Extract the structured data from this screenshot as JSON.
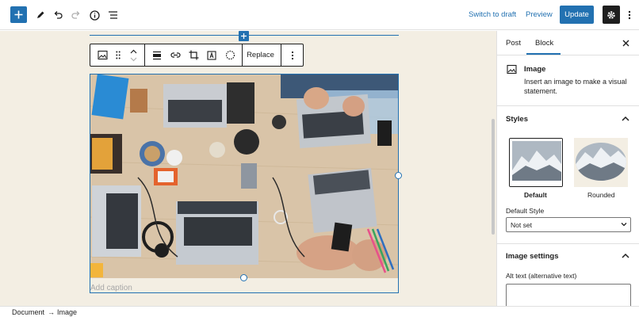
{
  "toolbar": {
    "add_icon": "plus-icon",
    "tools_icon": "pencil-icon",
    "undo_icon": "undo-icon",
    "redo_icon": "redo-icon",
    "info_icon": "info-icon",
    "outline_icon": "list-view-icon",
    "switch_to_draft": "Switch to draft",
    "preview": "Preview",
    "update": "Update",
    "settings_icon": "gear-icon",
    "more_icon": "vertical-ellipsis-icon"
  },
  "block_toolbar": {
    "replace_label": "Replace",
    "icons": [
      "image-icon",
      "drag-handle-icon",
      "move-arrows-icon",
      "align-icon",
      "link-icon",
      "crop-icon",
      "text-overlay-icon",
      "select-circle-icon",
      "more-options-icon"
    ]
  },
  "image_block": {
    "caption_placeholder": "Add caption"
  },
  "sidebar": {
    "tabs": [
      {
        "label": "Post",
        "active": false
      },
      {
        "label": "Block",
        "active": true
      }
    ],
    "block_card": {
      "title": "Image",
      "description": "Insert an image to make a visual statement."
    },
    "styles_panel": {
      "title": "Styles",
      "options": [
        {
          "label": "Default",
          "selected": true
        },
        {
          "label": "Rounded",
          "selected": false
        }
      ],
      "default_style_label": "Default Style",
      "default_style_value": "Not set"
    },
    "image_settings_panel": {
      "title": "Image settings",
      "alt_text_label": "Alt text (alternative text)"
    }
  },
  "footer": {
    "breadcrumbs": [
      "Document",
      "Image"
    ]
  },
  "colors": {
    "accent": "#2271b1",
    "canvas_bg": "#f3eee3",
    "dark": "#1e1e1e"
  }
}
